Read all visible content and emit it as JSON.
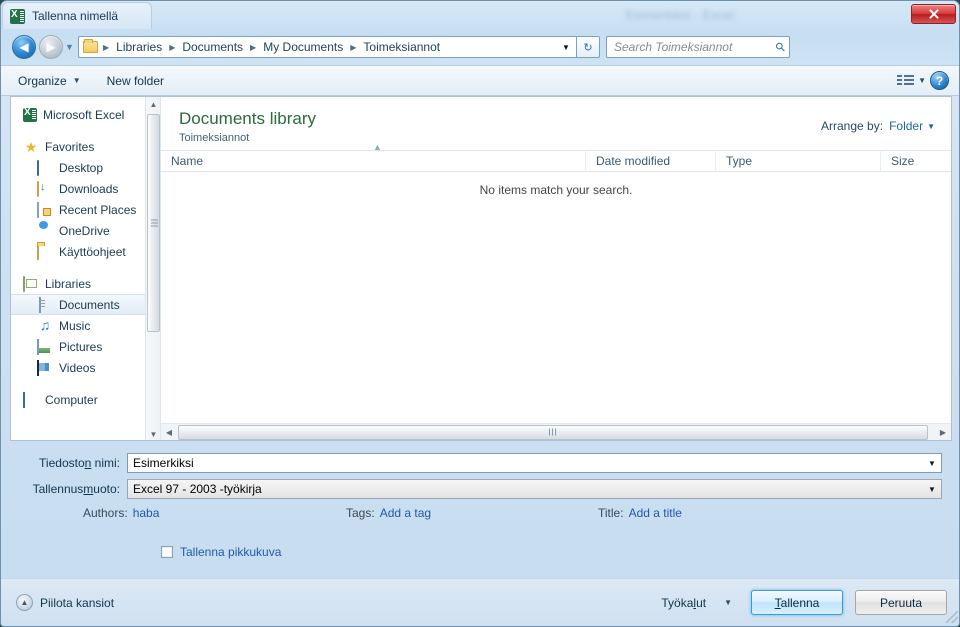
{
  "window": {
    "title": "Tallenna nimellä",
    "app_icon": "excel-icon",
    "background_app_text": "Esimerkiksi - Excel",
    "close_label": "✕"
  },
  "addressbar": {
    "back_arrow": "◀",
    "forward_arrow": "▶",
    "history_caret": "▼",
    "folder_icon": "folder-icon",
    "crumbs": [
      {
        "label": "Libraries"
      },
      {
        "label": "Documents"
      },
      {
        "label": "My Documents"
      },
      {
        "label": "Toimeksiannot"
      }
    ],
    "separator": "▶",
    "path_dropdown_caret": "▼",
    "refresh_icon": "↻",
    "search": {
      "placeholder": "Search Toimeksiannot",
      "icon": "search-icon",
      "value": ""
    }
  },
  "toolbar": {
    "organize_label": "Organize",
    "organize_caret": "▼",
    "new_folder_label": "New folder",
    "view_icon": "view-layout-icon",
    "view_caret": "▼",
    "help_label": "?"
  },
  "sidebar": {
    "groups": [
      {
        "items": [
          {
            "label": "Microsoft Excel",
            "icon": "excel-icon",
            "indent": false,
            "selected": false
          }
        ]
      },
      {
        "items": [
          {
            "label": "Favorites",
            "icon": "star-icon",
            "indent": false,
            "selected": false
          },
          {
            "label": "Desktop",
            "icon": "desktop-icon",
            "indent": true,
            "selected": false
          },
          {
            "label": "Downloads",
            "icon": "downloads-icon",
            "indent": true,
            "selected": false
          },
          {
            "label": "Recent Places",
            "icon": "recent-places-icon",
            "indent": true,
            "selected": false
          },
          {
            "label": "OneDrive",
            "icon": "onedrive-icon",
            "indent": true,
            "selected": false
          },
          {
            "label": "Käyttöohjeet",
            "icon": "folder-icon",
            "indent": true,
            "selected": false
          }
        ]
      },
      {
        "items": [
          {
            "label": "Libraries",
            "icon": "library-icon",
            "indent": false,
            "selected": false
          },
          {
            "label": "Documents",
            "icon": "documents-icon",
            "indent": true,
            "selected": true
          },
          {
            "label": "Music",
            "icon": "music-icon",
            "indent": true,
            "selected": false
          },
          {
            "label": "Pictures",
            "icon": "pictures-icon",
            "indent": true,
            "selected": false
          },
          {
            "label": "Videos",
            "icon": "videos-icon",
            "indent": true,
            "selected": false
          }
        ]
      },
      {
        "items": [
          {
            "label": "Computer",
            "icon": "computer-icon",
            "indent": false,
            "selected": false
          }
        ]
      }
    ],
    "scroll_up": "▲",
    "scroll_down": "▼"
  },
  "main": {
    "library_title": "Documents library",
    "library_subtitle": "Toimeksiannot",
    "arrange_label": "Arrange by:",
    "arrange_value": "Folder",
    "arrange_caret": "▼",
    "columns": [
      {
        "label": "Name"
      },
      {
        "label": "Date modified"
      },
      {
        "label": "Type"
      },
      {
        "label": "Size"
      }
    ],
    "sort_caret": "▲",
    "empty_message": "No items match your search.",
    "hscroll_left": "◀",
    "hscroll_right": "▶"
  },
  "form": {
    "filename_label_pre": "Tiedosto",
    "filename_label_accel": "n",
    "filename_label_post": " nimi:",
    "filename_value": "Esimerkiksi",
    "filetype_label_pre": "Tallennus",
    "filetype_label_accel": "m",
    "filetype_label_post": "uoto:",
    "filetype_value": "Excel 97 - 2003 -työkirja",
    "dropdown_caret": "▼",
    "authors_label": "Authors:",
    "authors_value": "haba",
    "tags_label": "Tags:",
    "tags_value": "Add a tag",
    "title_label": "Title:",
    "title_value": "Add a title",
    "thumbnail_label": "Tallenna pikkukuva",
    "thumbnail_checked": false
  },
  "footer": {
    "hide_folders_label": "Piilota kansiot",
    "hide_folders_caret": "▲",
    "tools_label_pre": "Työka",
    "tools_label_accel": "l",
    "tools_label_post": "ut",
    "tools_caret": "▼",
    "save_label_pre": "",
    "save_label_accel": "T",
    "save_label_post": "allenna",
    "cancel_label": "Peruuta"
  },
  "colors": {
    "accent_blue": "#2159a8",
    "library_green": "#2a6b3d",
    "close_red": "#d63c3c",
    "excel_green": "#217346"
  }
}
